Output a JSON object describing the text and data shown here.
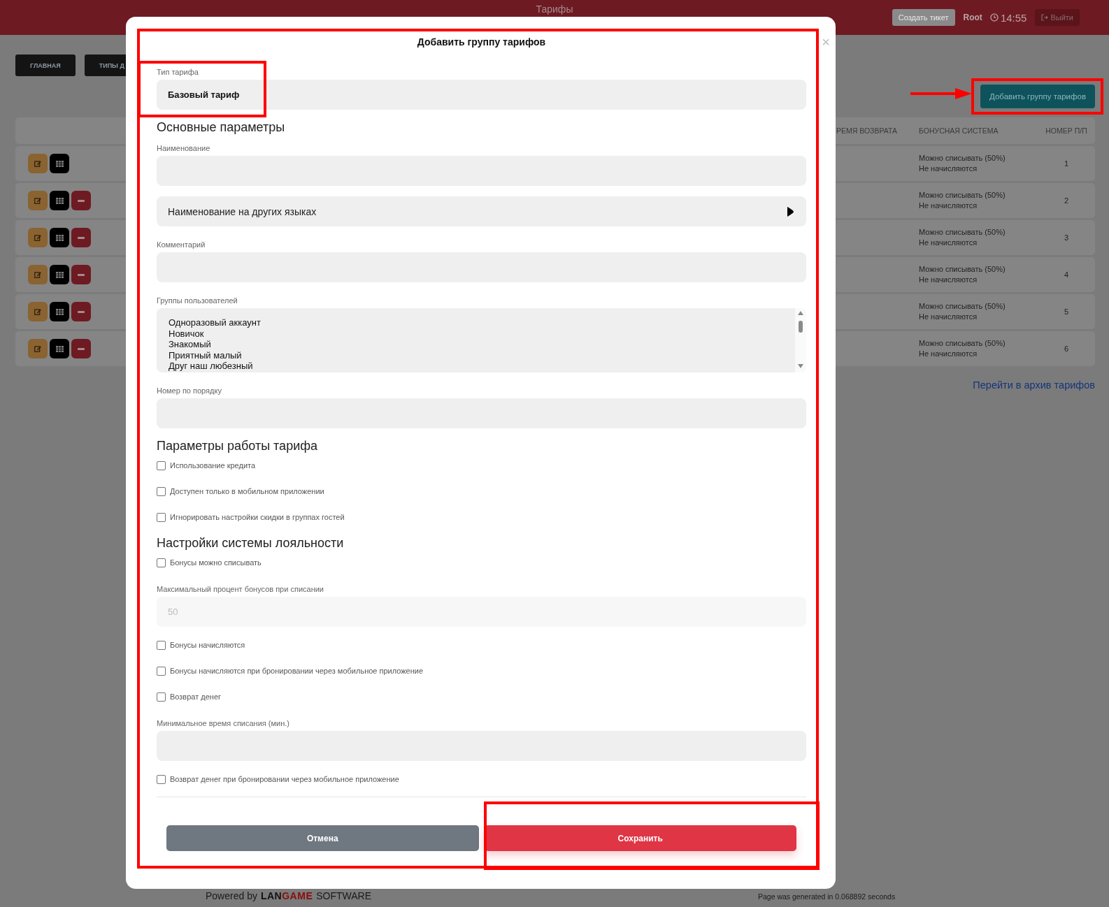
{
  "header": {
    "title": "Тарифы",
    "create_ticket": "Создать тикет",
    "user": "Root",
    "time": "14:55",
    "logout": "Выйти"
  },
  "nav": [
    {
      "label": "ГЛАВНАЯ"
    },
    {
      "label": "ТИПЫ Д"
    }
  ],
  "add_button": "Добавить группу тарифов",
  "table": {
    "columns": [
      "РЕМЯ ВОЗВРАТА",
      "БОНУСНАЯ СИСТЕМА",
      "НОМЕР П/П"
    ],
    "rows": [
      {
        "bonus": [
          "Можно списывать (50%)",
          "Не начисляются"
        ],
        "number": "1",
        "deletable": false
      },
      {
        "bonus": [
          "Можно списывать (50%)",
          "Не начисляются"
        ],
        "number": "2",
        "deletable": true
      },
      {
        "bonus": [
          "Можно списывать (50%)",
          "Не начисляются"
        ],
        "number": "3",
        "deletable": true
      },
      {
        "bonus": [
          "Можно списывать (50%)",
          "Не начисляются"
        ],
        "number": "4",
        "deletable": true
      },
      {
        "bonus": [
          "Можно списывать (50%)",
          "Не начисляются"
        ],
        "number": "5",
        "deletable": true
      },
      {
        "bonus": [
          "Можно списывать (50%)",
          "Не начисляются"
        ],
        "number": "6",
        "deletable": true
      }
    ]
  },
  "archive_link": "Перейти в архив тарифов",
  "footer": {
    "powered_by": "Powered by",
    "brand": [
      {
        "text": "LAN",
        "kind": "dark"
      },
      {
        "text": "GAME",
        "kind": "red"
      }
    ],
    "brand_suffix": "SOFTWARE",
    "generated": "Page was generated in 0.068892 seconds"
  },
  "modal": {
    "title": "Добавить группу тарифов",
    "close": "×",
    "form": [
      {
        "kind": "select",
        "label": "Тип тарифа",
        "value": "Базовый тариф"
      },
      {
        "kind": "heading",
        "text": "Основные параметры"
      },
      {
        "kind": "input",
        "label": "Наименование"
      },
      {
        "kind": "collapse",
        "text": "Наименование на других языках",
        "expanded": false
      },
      {
        "kind": "input",
        "label": "Комментарий"
      },
      {
        "kind": "listbox",
        "label": "Группы пользователей",
        "options": [
          "Одноразовый аккаунт",
          "Новичок",
          "Знакомый",
          "Приятный малый",
          "Друг наш любезный"
        ]
      },
      {
        "kind": "input",
        "label": "Номер по порядку"
      },
      {
        "kind": "heading",
        "text": "Параметры работы тарифа"
      },
      {
        "kind": "checkbox",
        "label": "Использование кредита",
        "checked": false
      },
      {
        "kind": "checkbox",
        "label": "Доступен только в мобильном приложении",
        "checked": false
      },
      {
        "kind": "checkbox",
        "label": "Игнорировать настройки скидки в группах гостей",
        "checked": false
      },
      {
        "kind": "heading",
        "text": "Настройки системы лояльности"
      },
      {
        "kind": "checkbox",
        "label": "Бонусы можно списывать",
        "checked": false
      },
      {
        "kind": "input",
        "label": "Максимальный процент бонусов при списании",
        "value": "50",
        "disabled": true
      },
      {
        "kind": "checkbox",
        "label": "Бонусы начисляются",
        "checked": false
      },
      {
        "kind": "checkbox",
        "label": "Бонусы начисляются при бронировании через мобильное приложение",
        "checked": false
      },
      {
        "kind": "checkbox",
        "label": "Возврат денег",
        "checked": false
      },
      {
        "kind": "input",
        "label": "Минимальное время списания (мин.)"
      },
      {
        "kind": "checkbox",
        "label": "Возврат денег при бронировании через мобильное приложение",
        "checked": false
      }
    ],
    "buttons": [
      {
        "label": "Отмена",
        "kind": "secondary"
      },
      {
        "label": "Сохранить",
        "kind": "primary"
      }
    ]
  }
}
